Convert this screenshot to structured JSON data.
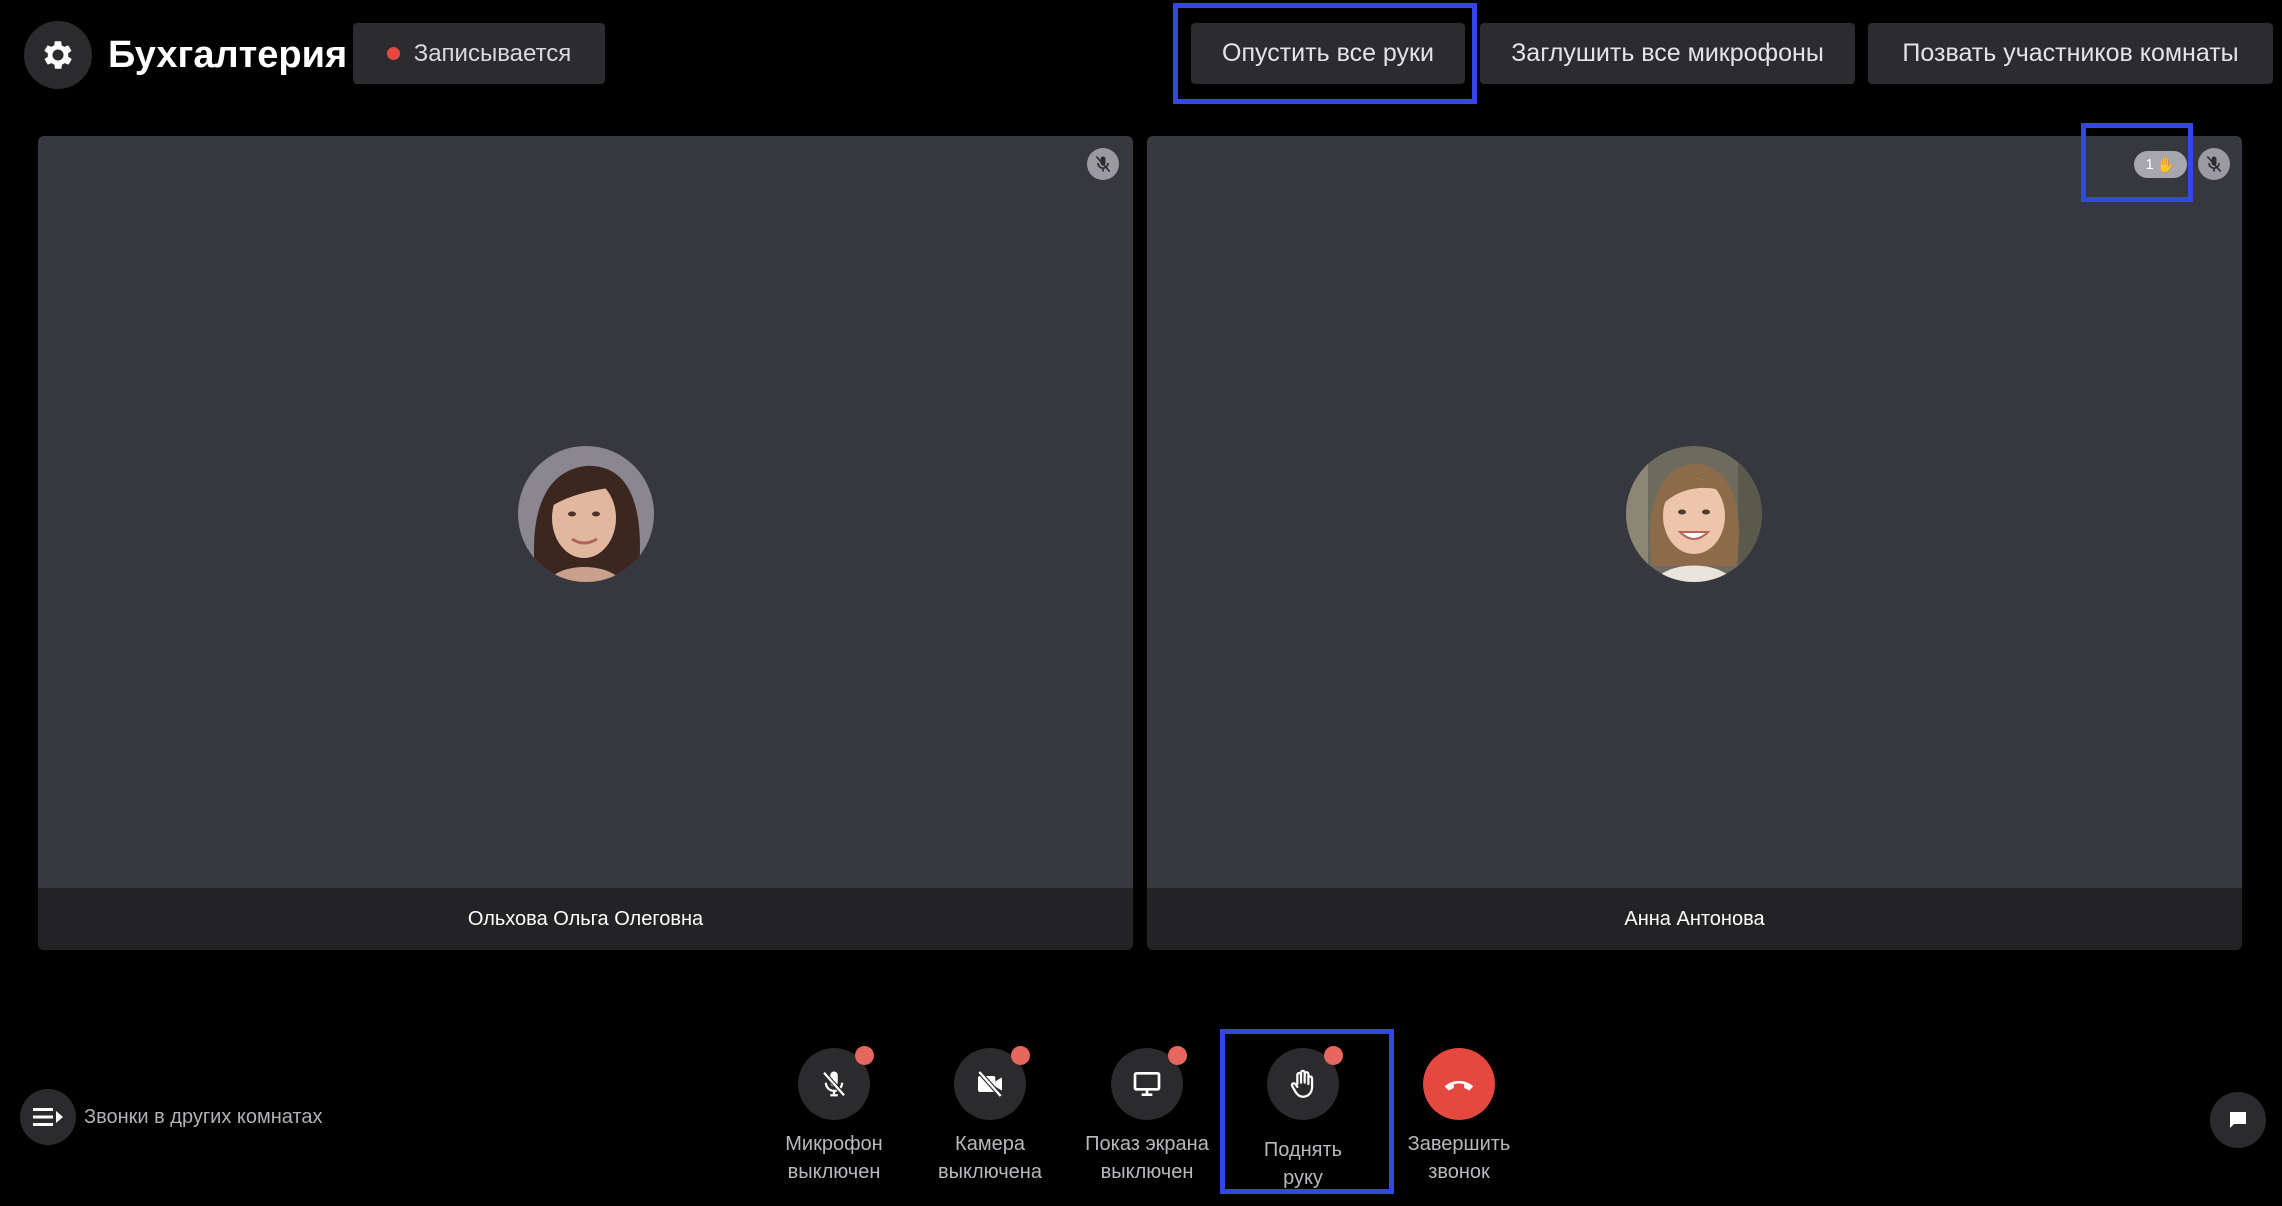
{
  "header": {
    "settings_icon": "gear-icon",
    "room_title": "Бухгалтерия",
    "recording_label": "Записывается",
    "recording_color": "#e5483f",
    "lower_hands_label": "Опустить все руки",
    "mute_all_label": "Заглушить все микрофоны",
    "call_room_label": "Позвать участников комнаты"
  },
  "participants": [
    {
      "name": "Ольхова Ольга Олеговна",
      "mic_icon": "mic-off-icon"
    },
    {
      "name": "Анна Антонова",
      "mic_icon": "mic-off-icon",
      "raised_hands": "1",
      "hand_emoji": "✋"
    }
  ],
  "bottom": {
    "other_calls_label": "Звонки в других комнатах",
    "controls": {
      "mic": "Микрофон\nвыключен",
      "camera": "Камера\nвыключена",
      "screen": "Показ экрана\nвыключен",
      "hand": "Поднять\nруку",
      "end": "Завершить\nзвонок"
    },
    "end_call_color": "#e5483f"
  },
  "highlight_color": "#3347e6"
}
